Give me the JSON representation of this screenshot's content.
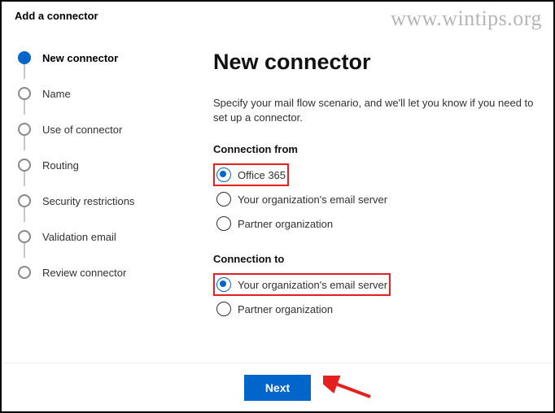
{
  "header": {
    "title": "Add a connector"
  },
  "watermark": "www.wintips.org",
  "steps": [
    {
      "label": "New connector",
      "active": true
    },
    {
      "label": "Name",
      "active": false
    },
    {
      "label": "Use of connector",
      "active": false
    },
    {
      "label": "Routing",
      "active": false
    },
    {
      "label": "Security restrictions",
      "active": false
    },
    {
      "label": "Validation email",
      "active": false
    },
    {
      "label": "Review connector",
      "active": false
    }
  ],
  "main": {
    "title": "New connector",
    "description": "Specify your mail flow scenario, and we'll let you know if you need to set up a connector.",
    "from_label": "Connection from",
    "from_options": [
      {
        "label": "Office 365",
        "selected": true,
        "highlight": true
      },
      {
        "label": "Your organization's email server",
        "selected": false,
        "highlight": false
      },
      {
        "label": "Partner organization",
        "selected": false,
        "highlight": false
      }
    ],
    "to_label": "Connection to",
    "to_options": [
      {
        "label": "Your organization's email server",
        "selected": true,
        "highlight": true
      },
      {
        "label": "Partner organization",
        "selected": false,
        "highlight": false
      }
    ]
  },
  "footer": {
    "next": "Next"
  }
}
